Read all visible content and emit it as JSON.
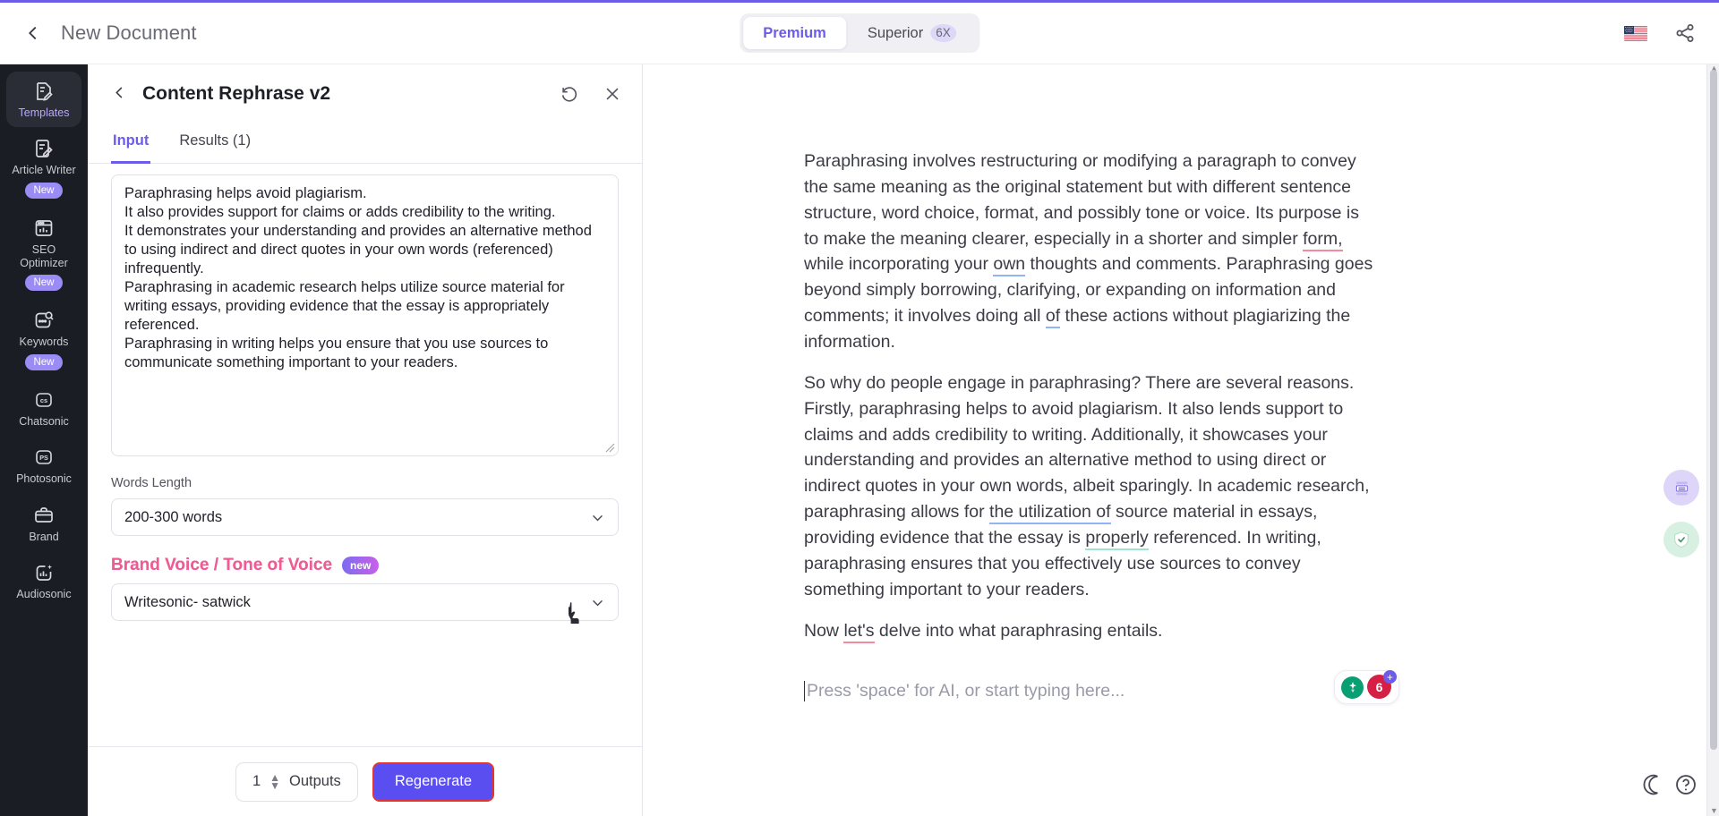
{
  "header": {
    "back_icon": "chevron-left-icon",
    "doc_title": "New Document",
    "segments": [
      {
        "label": "Premium",
        "multiplier": "",
        "active": true
      },
      {
        "label": "Superior",
        "multiplier": "6X",
        "active": false
      }
    ],
    "flag_icon": "us-flag-icon",
    "share_icon": "share-icon"
  },
  "sidebar": {
    "items": [
      {
        "label": "Templates",
        "icon": "templates-icon",
        "badge": "",
        "active": true
      },
      {
        "label": "Article Writer",
        "icon": "article-writer-icon",
        "badge": "New",
        "active": false
      },
      {
        "label": "SEO Optimizer",
        "icon": "seo-optimizer-icon",
        "badge": "New",
        "active": false
      },
      {
        "label": "Keywords",
        "icon": "keywords-icon",
        "badge": "New",
        "active": false
      },
      {
        "label": "Chatsonic",
        "icon": "chatsonic-icon",
        "badge": "",
        "active": false
      },
      {
        "label": "Photosonic",
        "icon": "photosonic-icon",
        "badge": "",
        "active": false
      },
      {
        "label": "Brand",
        "icon": "brand-icon",
        "badge": "",
        "active": false
      },
      {
        "label": "Audiosonic",
        "icon": "audiosonic-icon",
        "badge": "",
        "active": false
      }
    ]
  },
  "panel": {
    "back_icon": "chevron-left-icon",
    "title": "Content Rephrase v2",
    "refresh_icon": "history-reset-icon",
    "close_icon": "close-icon",
    "tabs": [
      {
        "label": "Input",
        "active": true
      },
      {
        "label": "Results (1)",
        "active": false
      }
    ],
    "input_textarea": {
      "value": "Paraphrasing helps avoid plagiarism.\nIt also provides support for claims or adds credibility to the writing.\nIt demonstrates your understanding and provides an alternative method to using indirect and direct quotes in your own words (referenced) infrequently.\nParaphrasing in academic research helps utilize source material for writing essays, providing evidence that the essay is appropriately referenced.\nParaphrasing in writing helps you ensure that you use sources to communicate something important to your readers."
    },
    "words_length": {
      "label": "Words Length",
      "value": "200-300 words",
      "chevron_icon": "chevron-down-icon"
    },
    "brand_voice": {
      "label": "Brand Voice / Tone of Voice",
      "badge": "new",
      "value": "Writesonic- satwick",
      "chevron_icon": "chevron-down-icon"
    },
    "footer": {
      "outputs_count": "1",
      "outputs_label": "Outputs",
      "regenerate_label": "Regenerate"
    }
  },
  "editor": {
    "paragraphs": [
      {
        "segments": [
          {
            "text": "Paraphrasing involves restructuring or modifying a paragraph to convey the same meaning as the original statement but with different sentence structure, word choice, format, and possibly tone or voice. Its purpose is to make the meaning clearer, especially in a shorter and simpler ",
            "underline": ""
          },
          {
            "text": "form,",
            "underline": "red"
          },
          {
            "text": " while incorporating your ",
            "underline": ""
          },
          {
            "text": "own",
            "underline": "blue"
          },
          {
            "text": " thoughts and comments. Paraphrasing goes beyond simply borrowing, clarifying, or expanding on information and comments; it involves doing all ",
            "underline": ""
          },
          {
            "text": "of",
            "underline": "blue"
          },
          {
            "text": " these actions without plagiarizing the information.",
            "underline": ""
          }
        ]
      },
      {
        "segments": [
          {
            "text": "So why do people engage in paraphrasing? There are several reasons. Firstly, paraphrasing helps to avoid plagiarism. It also lends support to claims and adds credibility to writing. Additionally, it showcases your understanding and provides an alternative method to using direct or indirect quotes in your own words, albeit sparingly. In academic research, paraphrasing allows for ",
            "underline": ""
          },
          {
            "text": "the utilization of",
            "underline": "blue"
          },
          {
            "text": " source material in essays, providing evidence that the essay is ",
            "underline": ""
          },
          {
            "text": "properly",
            "underline": "green"
          },
          {
            "text": " referenced. In writing, paraphrasing ensures that you effectively use sources to convey something important to your readers.",
            "underline": ""
          }
        ]
      },
      {
        "segments": [
          {
            "text": "Now ",
            "underline": ""
          },
          {
            "text": "let's",
            "underline": "red"
          },
          {
            "text": " delve into what paraphrasing entails.",
            "underline": ""
          }
        ]
      }
    ],
    "placeholder": "Press 'space' for AI, or start typing here...",
    "badges": {
      "bulb_icon": "lightbulb-idea-icon",
      "score_value": "6",
      "plus_icon": "plus-icon"
    },
    "rail": [
      {
        "icon": "document-outline-icon",
        "color": "#ddd6f8"
      },
      {
        "icon": "shield-check-icon",
        "color": "#d8f0e2"
      }
    ],
    "help": {
      "moon_icon": "moon-icon",
      "help_icon": "help-circle-icon"
    }
  },
  "colors": {
    "accent": "#6c5ce7",
    "sidebar_bg": "#1b1d24",
    "brand_pink": "#ef5b93",
    "regenerate_bg": "#5b4ef0",
    "highlight_border": "#e8342a"
  }
}
